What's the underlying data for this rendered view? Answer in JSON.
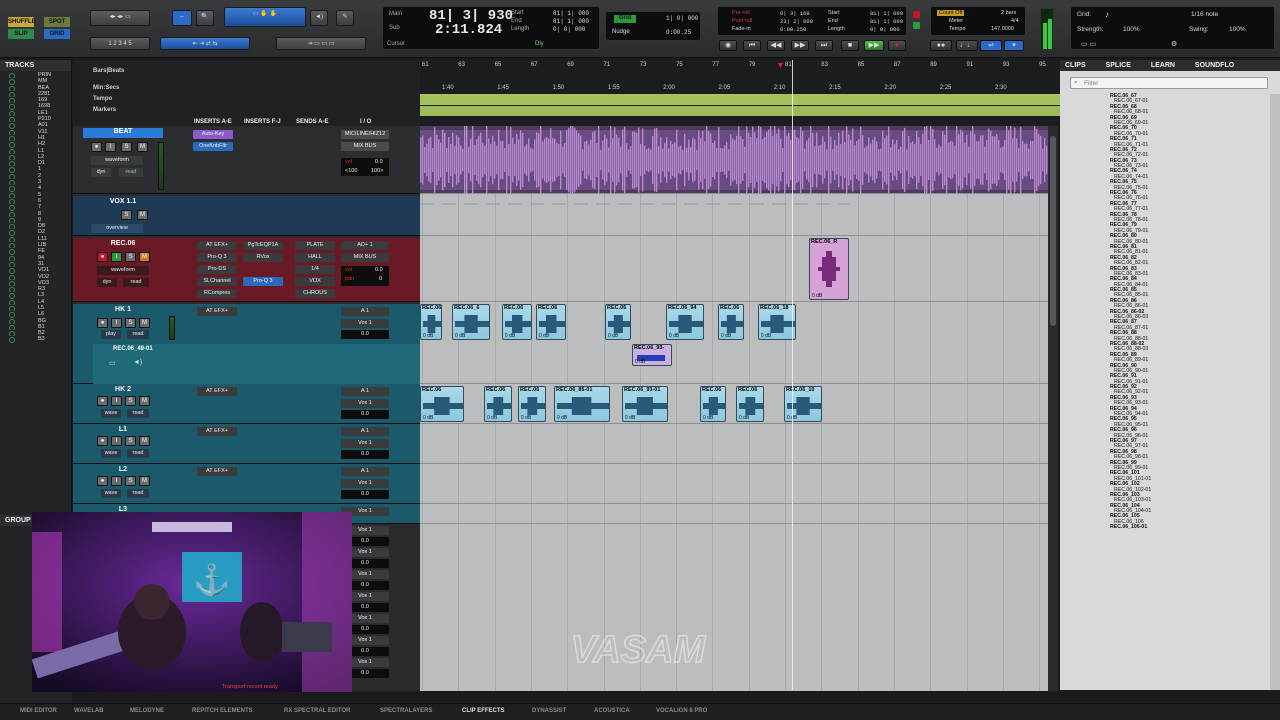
{
  "modes": [
    "SHUFFLE",
    "SPOT",
    "SLIP",
    "GRID"
  ],
  "counter": {
    "main_label": "Main",
    "sub_label": "Sub",
    "main_value": "81| 3| 930",
    "sub_value": "2:11.824",
    "start_label": "Start",
    "end_label": "End",
    "length_label": "Length",
    "start_value": "81| 1| 000",
    "end_value": "81| 1| 000",
    "length_value": "0| 0| 000",
    "cursor_label": "Cursor",
    "dly_label": "Dly"
  },
  "grid": {
    "grid_label": "Grid",
    "grid_value": "1| 0| 000",
    "nudge_label": "Nudge",
    "nudge_value": "0:00.25"
  },
  "preroll": {
    "preroll_label": "Pre-roll",
    "preroll_value": "0| 3| 169",
    "postroll_label": "Post-roll",
    "postroll_value": "23| 2| 000",
    "fadein_label": "Fade-in",
    "fadein_value": "0:00.250",
    "start_label": "Start",
    "start_value": "81| 1| 000",
    "end_label": "End",
    "end_value": "81| 1| 000",
    "length_label": "Length",
    "length_value": "0| 0| 000"
  },
  "sync": {
    "countoff_label": "Count Off",
    "countoff_value": "2 bars",
    "meter_label": "Meter",
    "meter_value": "4/4",
    "tempo_label": "Tempo",
    "tempo_value": "147.0000"
  },
  "rightctl": {
    "grid_label": "Grid:",
    "grid_value": "1/16 note",
    "strength_label": "Strength:",
    "strength_value": "100%",
    "swing_label": "Swing:",
    "swing_value": "100%"
  },
  "rulers": {
    "bars_label": "Bars|Beats",
    "min_label": "Min:Secs",
    "tempo_label": "Tempo",
    "markers_label": "Markers",
    "bars": [
      "61",
      "63",
      "65",
      "67",
      "69",
      "71",
      "73",
      "75",
      "77",
      "79",
      "81",
      "83",
      "85",
      "87",
      "89",
      "91",
      "93",
      "95"
    ],
    "mins": [
      "1:40",
      "1:45",
      "1:50",
      "1:55",
      "2:00",
      "2:05",
      "2:10",
      "2:15",
      "2:20",
      "2:25",
      "2:30"
    ]
  },
  "columns": {
    "inserts_ae": "INSERTS A-E",
    "inserts_fj": "INSERTS F-J",
    "sends_ae": "SENDS A-E",
    "io": "I / O"
  },
  "tracks_panel": {
    "title": "TRACKS",
    "items": [
      "PRIN",
      "MM",
      "BEA",
      "2281",
      "169",
      "1698",
      "LE1",
      "P210",
      "A01",
      "V11",
      "H1",
      "H2",
      "L1",
      "L2",
      "D1",
      "1",
      "2",
      "3",
      "4",
      "5",
      "6",
      "7",
      "8",
      "9",
      "D8",
      "D2",
      "L11",
      "LIB",
      "FE",
      "94",
      "31",
      "VO1",
      "VO2",
      "VO3",
      "R3",
      "L3",
      "L4",
      "L5",
      "L6",
      "BG",
      "B1",
      "B2",
      "B3"
    ]
  },
  "groups_panel": {
    "title": "GROUP"
  },
  "channels": {
    "beat": {
      "name": "BEAT",
      "insert1": "Auto-Key",
      "insert2": "OneKnbFltr",
      "io_in": "MIC/LINE/HIZ12",
      "io_out": "MIX BUS",
      "vol_label": "vol",
      "vol_value": "0.0",
      "pan": "<100",
      "pan2": "100>",
      "view": "waveform",
      "auto": "dyn",
      "auto2": "read"
    },
    "vox": {
      "name": "VOX 1.1",
      "view": "overview"
    },
    "rec": {
      "name": "REC.06",
      "ins": [
        "AT EFX+",
        "Pro-Q 3",
        "Pro-DS",
        "SLChannel",
        "RCompres"
      ],
      "ins2": [
        "PgTcEQP1A",
        "RVox",
        "",
        "Pro-Q 3"
      ],
      "sends": [
        "PLATE",
        "HALL",
        "1/4",
        "VOX",
        "CHROUS"
      ],
      "io_in": "AD+ 1",
      "io_out": "MIX BUS",
      "vol_label": "vol",
      "vol_value": "0.0",
      "pan_label": "pan",
      "pan_value": "0",
      "view": "waveform",
      "auto": "dyn",
      "auto2": "read"
    },
    "hk1": {
      "name": "HK 1",
      "ins": "AT EFX+",
      "io_in": "A 1",
      "io_out": "Vox 1",
      "vol": "0.0",
      "auto": "play",
      "auto2": "read",
      "sub": "REC.06_49-01"
    },
    "hk2": {
      "name": "HK 2",
      "ins": "AT EFX+",
      "io_in": "A 1",
      "io_out": "Vox 1",
      "vol": "0.0",
      "auto": "wave",
      "auto2": "read"
    },
    "l1": {
      "name": "L1",
      "ins": "AT EFX+",
      "io_in": "A 1",
      "io_out": "Vox 1",
      "vol": "0.0",
      "auto": "wave",
      "auto2": "read"
    },
    "l2": {
      "name": "L2",
      "ins": "AT EFX+",
      "io_in": "A 1",
      "io_out": "Vox 1",
      "vol": "0.0",
      "auto": "wave",
      "auto2": "read"
    },
    "l3": {
      "name": "L3",
      "io_out": "Vox 1",
      "vol": "0.0"
    },
    "extra_out": "Vox 1",
    "extra_vol": "0.0"
  },
  "clips_edit": {
    "rec_clip": "REC.06_R",
    "rec_gain": "0 dB",
    "hk1": [
      "REC.06",
      "REC.06_6",
      "REC.06",
      "REC.06",
      "REC.06",
      "REC.06_94",
      "REC.06",
      "REC.06_18"
    ],
    "hk1_sub": "REC.06_93-",
    "hk2": [
      "REC.06",
      "REC.06",
      "REC.06",
      "REC.06_85-01",
      "REC.06_93-01",
      "REC.06",
      "REC.06",
      "REC.06_10"
    ],
    "gain": "0 dB"
  },
  "clips_panel": {
    "tabs": [
      "CLIPS",
      "SPLICE",
      "LEARN",
      "SOUNDFLO"
    ],
    "filter_placeholder": "Filter",
    "items": [
      "REC.06_67",
      "REC.06_67-01",
      "REC.06_68",
      "REC.06_68-01",
      "REC.06_69",
      "REC.06_69-01",
      "REC.06_70",
      "REC.06_70-01",
      "REC.06_71",
      "REC.06_71-01",
      "REC.06_72",
      "REC.06_72-01",
      "REC.06_73",
      "REC.06_73-01",
      "REC.06_74",
      "REC.06_74-01",
      "REC.06_75",
      "REC.06_75-01",
      "REC.06_76",
      "REC.06_76-01",
      "REC.06_77",
      "REC.06_77-01",
      "REC.06_78",
      "REC.06_78-01",
      "REC.06_79",
      "REC.06_79-01",
      "REC.06_80",
      "REC.06_80-01",
      "REC.06_81",
      "REC.06_81-01",
      "REC.06_82",
      "REC.06_82-01",
      "REC.06_83",
      "REC.06_83-01",
      "REC.06_84",
      "REC.06_84-01",
      "REC.06_85",
      "REC.06_85-01",
      "REC.06_86",
      "REC.06_86-01",
      "REC.06_86-02",
      "REC.06_86-03",
      "REC.06_87",
      "REC.06_87-01",
      "REC.06_88",
      "REC.06_88-01",
      "REC.06_88-02",
      "REC.06_88-03",
      "REC.06_89",
      "REC.06_89-01",
      "REC.06_90",
      "REC.06_90-01",
      "REC.06_91",
      "REC.06_91-01",
      "REC.06_92",
      "REC.06_92-01",
      "REC.06_93",
      "REC.06_93-01",
      "REC.06_94",
      "REC.06_94-01",
      "REC.06_95",
      "REC.06_95-01",
      "REC.06_96",
      "REC.06_96-01",
      "REC.06_97",
      "REC.06_97-01",
      "REC.06_98",
      "REC.06_98-01",
      "REC.06_99",
      "REC.06_99-01",
      "REC.06_101",
      "REC.06_101-01",
      "REC.06_102",
      "REC.06_102-01",
      "REC.06_103",
      "REC.06_103-01",
      "REC.06_104",
      "REC.06_104-01",
      "REC.06_105",
      "REC.06_106",
      "REC.06_106-01"
    ]
  },
  "bottom_plugins": [
    "MIDI EDITOR",
    "WAVELAB",
    "MELODYNE",
    "REPITCH ELEMENTS",
    "RX SPECTRAL EDITOR",
    "SPECTRALAYERS",
    "CLIP EFFECTS",
    "DYNASSIST",
    "ACOUSTICA",
    "VOCALIGN 6 PRO"
  ],
  "watermark": "VASAM",
  "webcam_caption": "Transport record ready",
  "colors": {
    "accent": "#2a8ad8",
    "rec_red": "#c0182a",
    "waveform_purple": "#9b5ab8",
    "clip_blue": "#9dd4e6",
    "playhead": "#ffffff",
    "tempo_green": "#a6c25a"
  }
}
